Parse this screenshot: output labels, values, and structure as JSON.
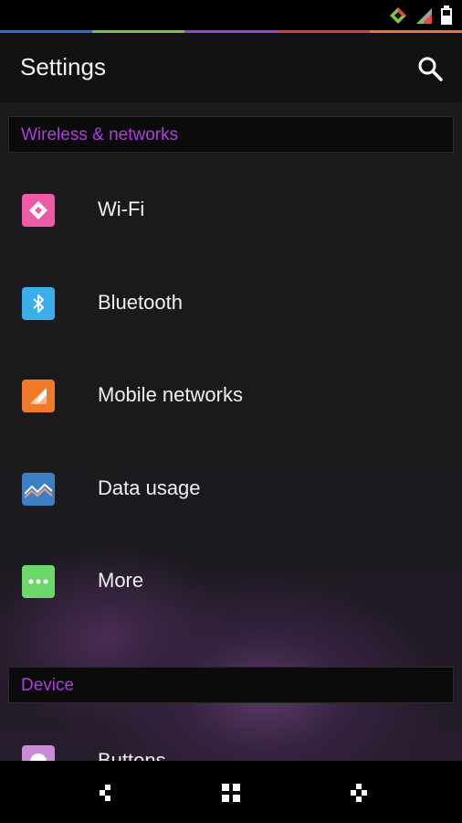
{
  "status_bar": {
    "icons": [
      "signal-diamond-icon",
      "cell-signal-icon",
      "battery-icon"
    ],
    "accent_colors": [
      "#2a6fd6",
      "#79c244",
      "#a43fd8",
      "#e23a3a",
      "#e87a2c"
    ]
  },
  "action_bar": {
    "title": "Settings",
    "search_icon": "search-icon"
  },
  "sections": [
    {
      "header": "Wireless & networks",
      "items": [
        {
          "label": "Wi-Fi",
          "icon": "wifi-icon",
          "color": "#ee5aa5"
        },
        {
          "label": "Bluetooth",
          "icon": "bluetooth-icon",
          "color": "#3aaee8"
        },
        {
          "label": "Mobile networks",
          "icon": "mobile-networks-icon",
          "color": "#f07a2a"
        },
        {
          "label": "Data usage",
          "icon": "data-usage-icon",
          "color": "#3d7fc4"
        },
        {
          "label": "More",
          "icon": "more-icon",
          "color": "#6cd86a"
        }
      ]
    },
    {
      "header": "Device",
      "items": [
        {
          "label": "Buttons",
          "icon": "buttons-icon",
          "color": "#c98ad8"
        }
      ]
    }
  ],
  "nav_bar": {
    "back": "back-icon",
    "home": "home-icon",
    "recents": "recents-icon"
  }
}
